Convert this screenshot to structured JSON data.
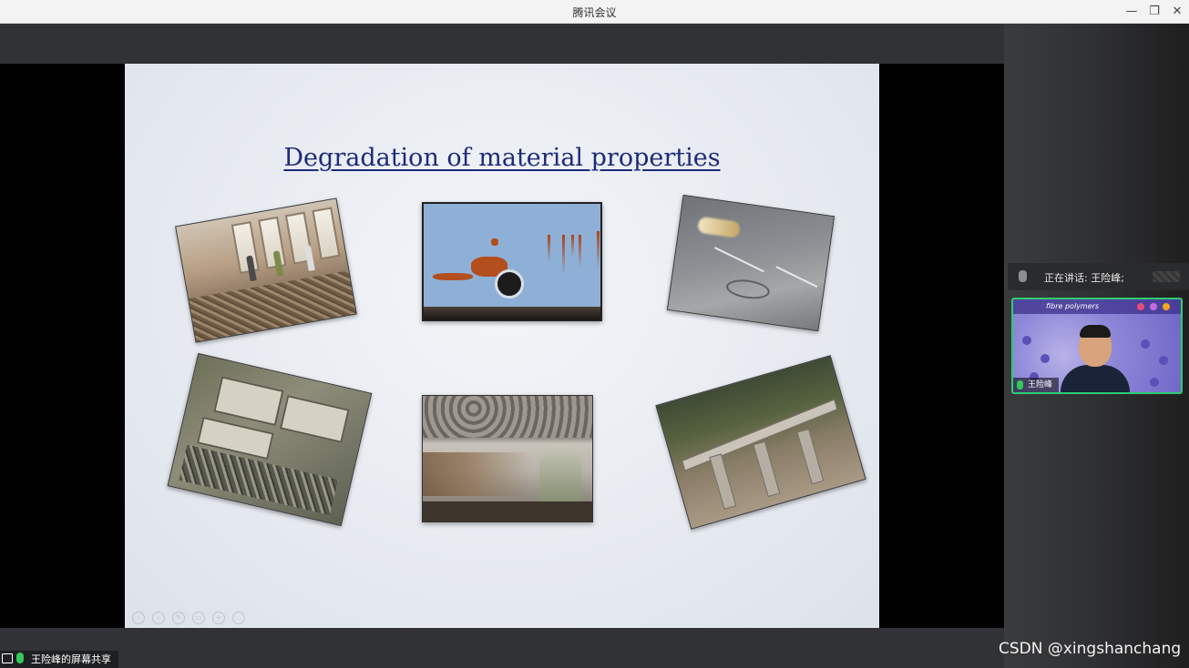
{
  "window": {
    "title": "腾讯会议"
  },
  "window_controls": {
    "minimize": "—",
    "maximize": "❐",
    "close": "✕"
  },
  "slide": {
    "title": "Degradation of material properties"
  },
  "share": {
    "label": "王险峰的屏幕共享"
  },
  "side_panel": {
    "speaking_label": "正在讲话: 王险峰;",
    "video_header": "fibre polymers",
    "participant_name": "王险峰"
  },
  "watermark": "CSDN @xingshanchang",
  "colors": {
    "speaker_border": "#2ecc71",
    "mic_active": "#34c759",
    "title_blue": "#1d2a7a"
  }
}
